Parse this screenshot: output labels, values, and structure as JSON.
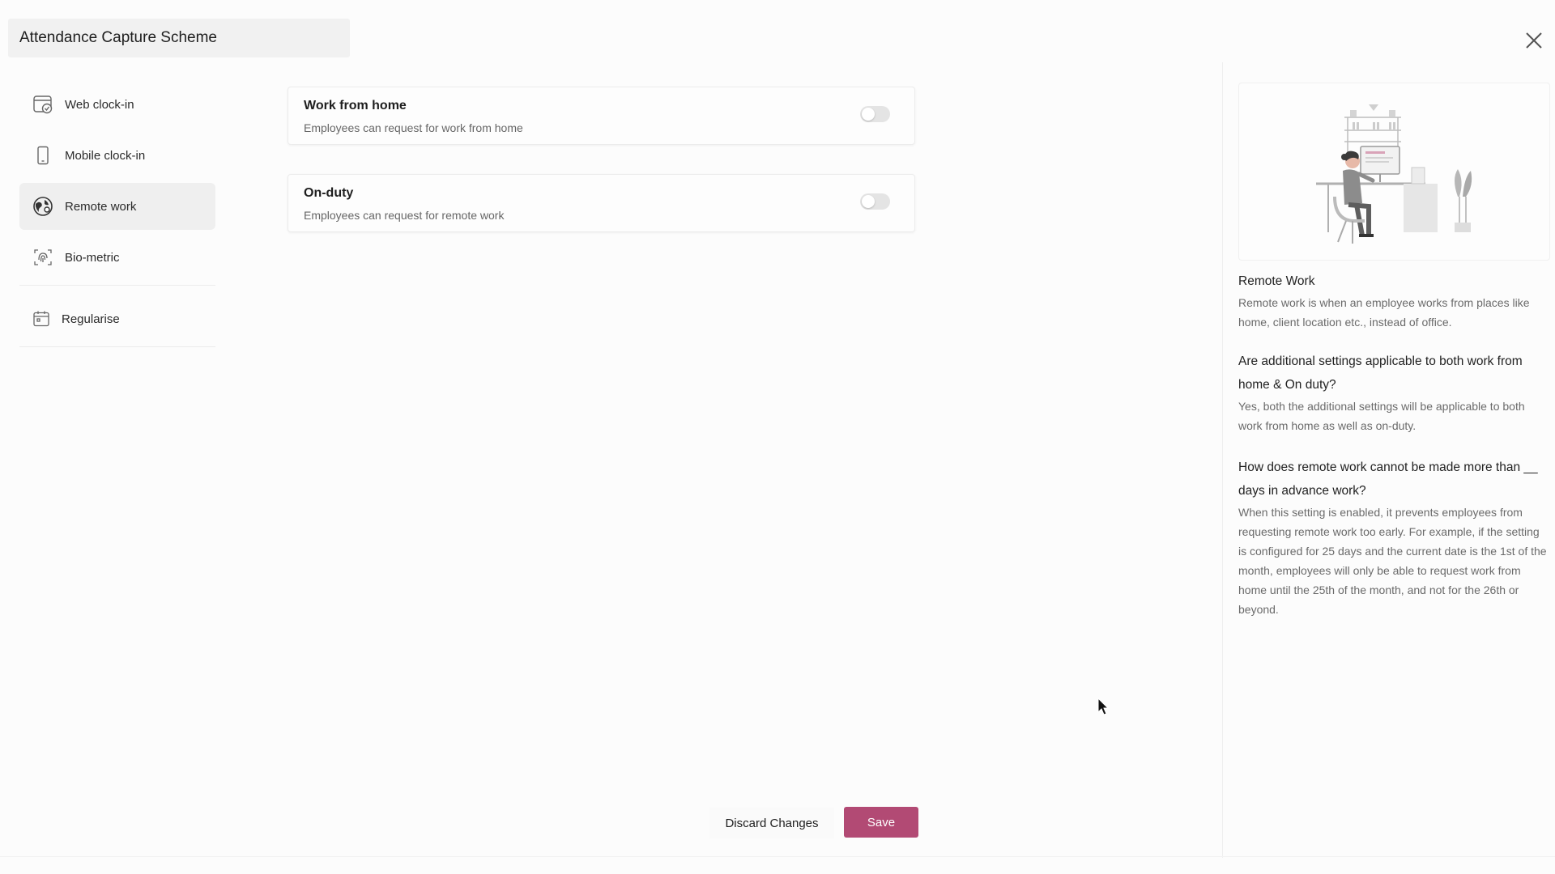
{
  "header": {
    "title": "Attendance Capture Scheme",
    "close_icon": "close-icon"
  },
  "sidebar": {
    "items": [
      {
        "label": "Web clock-in",
        "icon": "web-clock-icon",
        "active": false
      },
      {
        "label": "Mobile clock-in",
        "icon": "mobile-icon",
        "active": false
      },
      {
        "label": "Remote work",
        "icon": "remote-work-icon",
        "active": true
      },
      {
        "label": "Bio-metric",
        "icon": "fingerprint-icon",
        "active": false
      },
      {
        "label": "Regularise",
        "icon": "calendar-icon",
        "active": false
      }
    ]
  },
  "main": {
    "cards": [
      {
        "title": "Work from home",
        "description": "Employees can request for work from home",
        "enabled": false
      },
      {
        "title": "On-duty",
        "description": "Employees can request for remote work",
        "enabled": false
      }
    ]
  },
  "help": {
    "title": "Remote Work",
    "intro": "Remote work is when an employee works from places like home, client location etc., instead of office.",
    "faqs": [
      {
        "question": "Are additional settings applicable to both work from home & On duty?",
        "answer": "Yes, both the additional settings will be applicable to both work from home as well as on-duty."
      },
      {
        "question": "How does remote work cannot be made more than __ days in advance work?",
        "answer": "When this setting is enabled, it prevents employees from requesting remote work too early. For example, if the setting is configured for 25 days and the current date is the 1st of the month, employees will only be able to request work from home until the 25th of the month, and not for the 26th or beyond."
      }
    ]
  },
  "footer": {
    "discard_label": "Discard Changes",
    "save_label": "Save"
  },
  "colors": {
    "accent": "#b24a74",
    "active_nav_bg": "#efefef",
    "toggle_off": "#e4e4e4"
  }
}
